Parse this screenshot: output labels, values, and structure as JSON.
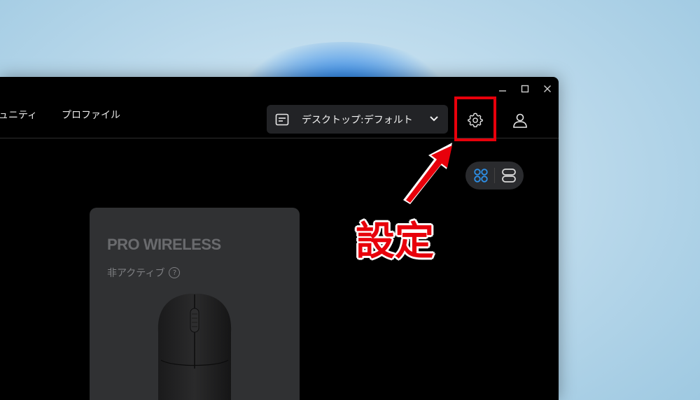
{
  "window": {
    "controls": {
      "minimize": "—",
      "maximize": "☐",
      "close": "✕"
    }
  },
  "nav": {
    "items": [
      {
        "label": "ュニティ"
      },
      {
        "label": "プロファイル"
      }
    ]
  },
  "profile_selector": {
    "icon": "profile-card-icon",
    "label": "デスクトップ:デフォルト",
    "chevron": "chevron-down-icon"
  },
  "header_actions": {
    "settings_icon": "gear-icon",
    "account_icon": "user-icon"
  },
  "view_toggle": {
    "options": [
      {
        "icon": "grid-view-icon",
        "active": true
      },
      {
        "icon": "list-view-icon",
        "active": false
      }
    ],
    "active_color": "#2d8fe6"
  },
  "device_card": {
    "name": "PRO WIRELESS",
    "status": "非アクティブ",
    "help": "?"
  },
  "annotation": {
    "text": "設定",
    "color": "#e8000b"
  }
}
